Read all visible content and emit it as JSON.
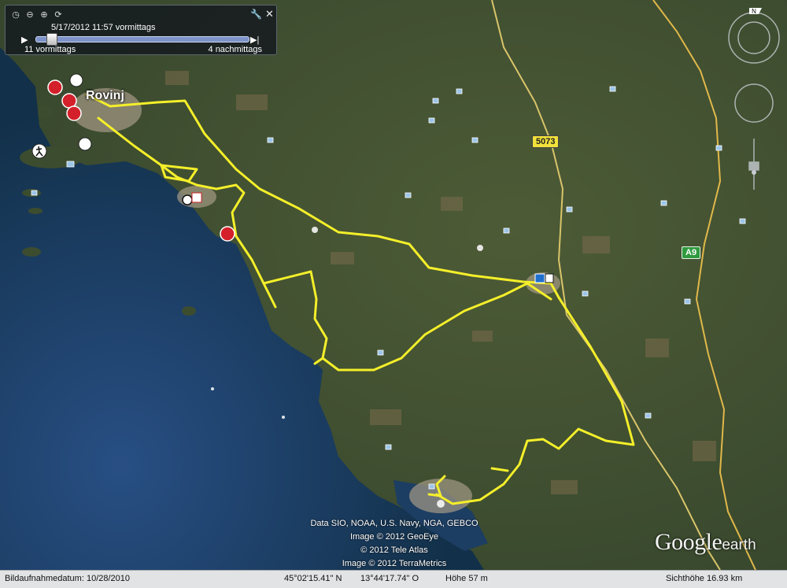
{
  "timeslider": {
    "date_label": "5/17/2012 11:57 vormittags",
    "start_label": "11 vormittags",
    "end_label": "4 nachmittags",
    "progress": 0.05
  },
  "map": {
    "place_label": "Rovinj",
    "road_labels": [
      "5073",
      "A9"
    ],
    "track_color": "#f4ef2a",
    "marker_icons": [
      "panorama-360-icon",
      "hiker-icon",
      "camera-icon",
      "hotel-icon",
      "gas-station-icon"
    ]
  },
  "attribution": [
    "Data SIO, NOAA, U.S. Navy, NGA, GEBCO",
    "Image © 2012 GeoEye",
    "© 2012 Tele Atlas",
    "Image © 2012 TerraMetrics"
  ],
  "logo": {
    "google": "Google",
    "earth": "earth"
  },
  "statusbar": {
    "imagery_date": "Bildaufnahmedatum: 10/28/2010",
    "latitude": "45°02'15.41\" N",
    "longitude": "13°44'17.74\" O",
    "elevation": "Höhe 57 m",
    "eye_altitude": "Sichthöhe 16.93 km"
  }
}
